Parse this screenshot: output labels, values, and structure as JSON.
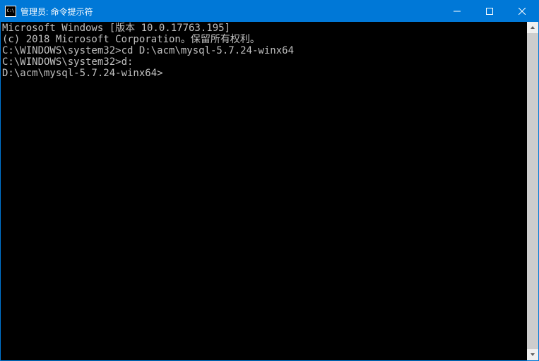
{
  "titlebar": {
    "icon_text": "C:\\",
    "title": "管理员: 命令提示符"
  },
  "terminal": {
    "lines": [
      "Microsoft Windows [版本 10.0.17763.195]",
      "(c) 2018 Microsoft Corporation。保留所有权利。",
      "",
      "C:\\WINDOWS\\system32>cd D:\\acm\\mysql-5.7.24-winx64",
      "",
      "C:\\WINDOWS\\system32>d:",
      "",
      "D:\\acm\\mysql-5.7.24-winx64>"
    ]
  }
}
